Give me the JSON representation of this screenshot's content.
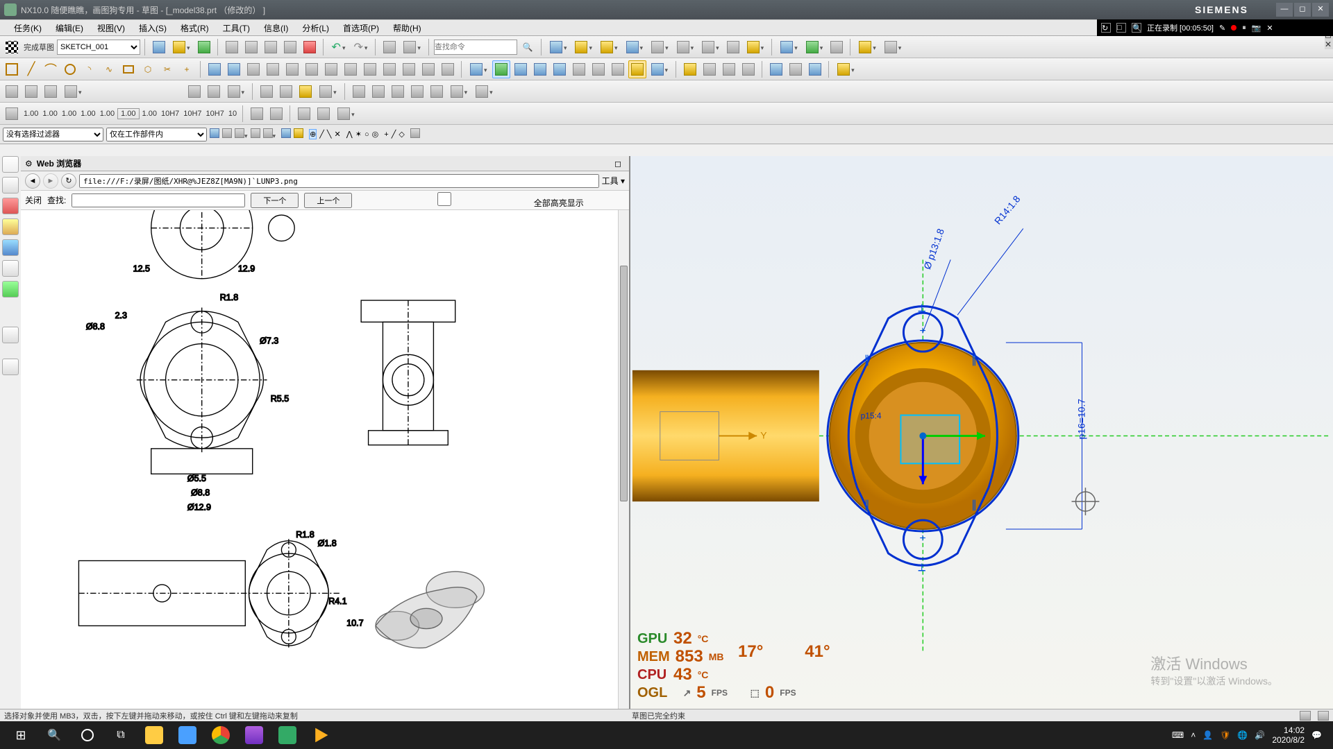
{
  "titlebar": {
    "app_title": "NX10.0 随便瞧瞧，画图狗专用 - 草图 - [_model38.prt （修改的） ]",
    "brand": "SIEMENS"
  },
  "recording": {
    "label": "正在录制 [00:05:50]"
  },
  "menubar": {
    "items": [
      "任务(K)",
      "编辑(E)",
      "视图(V)",
      "插入(S)",
      "格式(R)",
      "工具(T)",
      "信息(I)",
      "分析(L)",
      "首选项(P)",
      "帮助(H)"
    ]
  },
  "sketch_toolbar": {
    "finish_label": "完成草图",
    "sketch_name": "SKETCH_001",
    "search_placeholder": "查找命令"
  },
  "dimension_row": {
    "values": [
      "1.00",
      "1.00",
      "1.00",
      "1.00",
      "1.00",
      "1.00",
      "1.00",
      "10H7",
      "10H7",
      "10H7",
      "10"
    ]
  },
  "filter_row": {
    "filter_label": "没有选择过滤器",
    "scope_label": "仅在工作部件内"
  },
  "web_panel": {
    "header": "Web 浏览器",
    "url": "file:///F:/录屏/图纸/XHR@%JEZ8Z[MA9N)]`LUNP3.png",
    "tools_label": "工具",
    "close_label": "关闭",
    "find_label": "查找:",
    "next_label": "下一个",
    "prev_label": "上一个",
    "highlight_label": "全部高亮显示"
  },
  "drawing_dims": {
    "d1": "12.5",
    "d2": "12.9",
    "d3": "Ø7.3",
    "d4": "R1.8",
    "d5": "Ø5.5",
    "d6": "Ø8.8",
    "d7": "Ø12.9",
    "d8": "R4.1",
    "d9": "10.7",
    "d10": "R1.8",
    "d11": "Ø1.8",
    "d12": "R5.5",
    "d13": "Ø8.8",
    "d14": "2.3"
  },
  "viewport_dims": {
    "r14": "R14:1.8",
    "p13": "Ø p13:1.8",
    "p16": "p16=10.7",
    "p15": "p15:4"
  },
  "axis": {
    "y": "Y"
  },
  "hw_monitor": {
    "gpu_label": "GPU",
    "gpu_val": "32",
    "gpu_unit": "°C",
    "mem_label": "MEM",
    "mem_val": "853",
    "mem_unit": "MB",
    "cpu_label": "CPU",
    "cpu_val": "43",
    "cpu_unit": "°C",
    "ogl_label": "OGL",
    "ogl_val": "5",
    "ogl_unit": "FPS",
    "fps2_val": "0",
    "fps2_unit": "FPS",
    "extra1": "17°",
    "extra2": "41°"
  },
  "watermark": {
    "line1": "激活 Windows",
    "line2": "转到\"设置\"以激活 Windows。"
  },
  "statusbar": {
    "left": "选择对象并使用 MB3，双击，按下左键并拖动来移动，或按住 Ctrl 键和左键拖动来复制",
    "right": "草图已完全约束"
  },
  "taskbar": {
    "time": "14:02",
    "date": "2020/8/2"
  }
}
